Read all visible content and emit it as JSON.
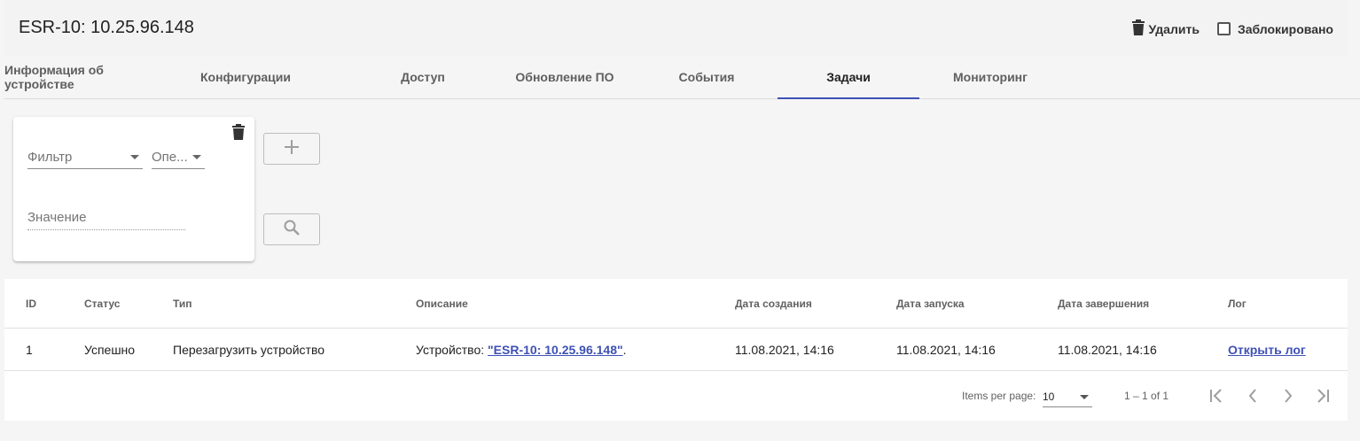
{
  "header": {
    "title": "ESR-10: 10.25.96.148",
    "delete_label": "Удалить",
    "lock_label": "Заблокировано"
  },
  "tabs": [
    {
      "label": "Информация об устройстве"
    },
    {
      "label": "Конфигурации"
    },
    {
      "label": "Доступ"
    },
    {
      "label": "Обновление ПО"
    },
    {
      "label": "События"
    },
    {
      "label": "Задачи",
      "active": true
    },
    {
      "label": "Мониторинг"
    }
  ],
  "filter": {
    "field_placeholder": "Фильтр",
    "operator_placeholder": "Опе...",
    "value_placeholder": "Значение"
  },
  "table": {
    "columns": [
      "ID",
      "Статус",
      "Тип",
      "Описание",
      "Дата создания",
      "Дата запуска",
      "Дата завершения",
      "Лог"
    ],
    "rows": [
      {
        "id": "1",
        "status": "Успешно",
        "type": "Перезагрузить устройство",
        "description_prefix": "Устройство: ",
        "description_link": "\"ESR-10: 10.25.96.148\"",
        "description_suffix": ".",
        "created": "11.08.2021, 14:16",
        "started": "11.08.2021, 14:16",
        "finished": "11.08.2021, 14:16",
        "log_link": "Открыть лог"
      }
    ]
  },
  "paginator": {
    "items_per_page_label": "Items per page:",
    "page_size": "10",
    "range_label": "1 – 1 of 1"
  },
  "colors": {
    "accent": "#3f51b5",
    "background": "#f5f5f5"
  }
}
